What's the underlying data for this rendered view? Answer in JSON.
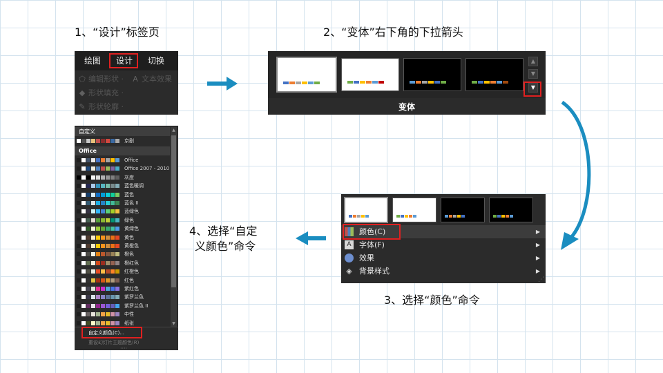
{
  "captions": {
    "step1": "1、“设计”标签页",
    "step2": "2、“变体”右下角的下拉箭头",
    "step3": "3、选择“颜色”命令",
    "step4_line1": "4、选择“自定",
    "step4_line2": "义颜色”命令"
  },
  "colors": {
    "arrow": "#1a8dc0",
    "highlight": "#e02020",
    "panel": "#2b2b2b"
  },
  "step1_ribbon": {
    "tabs": [
      "绘图",
      "设计",
      "切换"
    ],
    "active_tab": "设计",
    "menu_items": [
      {
        "icon": "edit-shape-icon",
        "label": "编辑形状 ·"
      },
      {
        "icon": "shape-fill-icon",
        "label": "形状填充 ·"
      },
      {
        "icon": "shape-outline-icon",
        "label": "形状轮廓 ·"
      }
    ],
    "text_effect": {
      "icon": "text-effect-icon",
      "label": "文本效果"
    }
  },
  "step2_variants": {
    "group_label": "变体",
    "dropdown_icon": "dropdown-more-icon"
  },
  "step3_menu": {
    "items": [
      {
        "icon": "color-palette-icon",
        "label": "颜色(C)"
      },
      {
        "icon": "font-icon",
        "label": "字体(F)"
      },
      {
        "icon": "effects-icon",
        "label": "效果"
      },
      {
        "icon": "background-style-icon",
        "label": "背景样式"
      }
    ]
  },
  "step4_colors": {
    "custom_header": "自定义",
    "custom_items": [
      "京剧"
    ],
    "office_header": "Office",
    "office_items": [
      "Office",
      "Office 2007 - 2010",
      "灰度",
      "蓝色暖调",
      "蓝色",
      "蓝色 II",
      "蓝绿色",
      "绿色",
      "黄绿色",
      "黄色",
      "黄橙色",
      "橙色",
      "橙红色",
      "红橙色",
      "红色",
      "紫红色",
      "紫罗兰色",
      "紫罗兰色 II",
      "中性",
      "纸张"
    ],
    "customize_command": "自定义颜色(C)...",
    "reset_command": "重设幻灯片主题颜色(R)"
  }
}
